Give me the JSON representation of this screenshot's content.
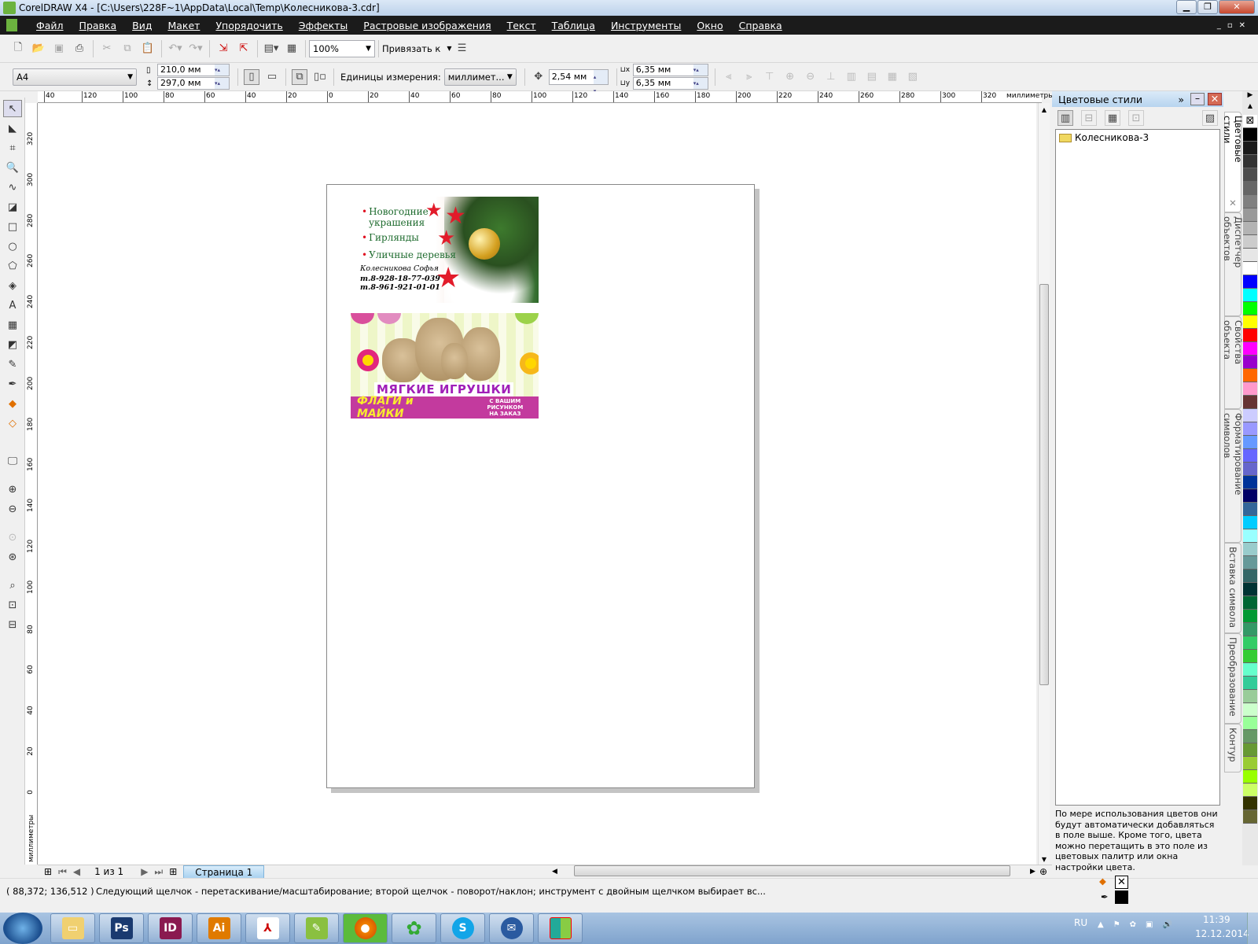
{
  "window": {
    "title": "CorelDRAW X4 - [C:\\Users\\228F~1\\AppData\\Local\\Temp\\Колесникова-3.cdr]"
  },
  "menu": [
    "Файл",
    "Правка",
    "Вид",
    "Макет",
    "Упорядочить",
    "Эффекты",
    "Растровые изображения",
    "Текст",
    "Таблица",
    "Инструменты",
    "Окно",
    "Справка"
  ],
  "toolbar": {
    "zoom": "100%",
    "snap": "Привязать к"
  },
  "propbar": {
    "paper": "A4",
    "width": "210,0 мм",
    "height": "297,0 мм",
    "units_label": "Единицы измерения:",
    "units": "миллимет...",
    "nudge": "2,54 мм",
    "dup_x": "6,35 мм",
    "dup_y": "6,35 мм"
  },
  "ruler": {
    "h_labels": [
      "40",
      "120",
      "100",
      "80",
      "60",
      "40",
      "20",
      "0",
      "20",
      "40",
      "60",
      "80",
      "100",
      "120",
      "140",
      "160",
      "180",
      "200",
      "220",
      "240",
      "260",
      "280",
      "300",
      "320"
    ],
    "units": "миллиметры",
    "v_labels": [
      "320",
      "300",
      "280",
      "260",
      "240",
      "220",
      "200",
      "180",
      "160",
      "140",
      "120",
      "100",
      "80",
      "60",
      "40",
      "20",
      "0"
    ]
  },
  "card1": {
    "items": [
      "Новогодние",
      "украшения",
      "Гирлянды",
      "Уличные деревья"
    ],
    "name": "Колесникова Софья",
    "phone1": "т.8-928-18-77-039",
    "phone2": "т.8-961-921-01-01"
  },
  "card2": {
    "title": "МЯГКИЕ ИГРУШКИ",
    "band": "ФЛАГИ и МАЙКИ",
    "sub1": "С ВАШИМ РИСУНКОМ",
    "sub2": "НА ЗАКАЗ"
  },
  "pagenav": {
    "count": "1 из 1",
    "tab": "Страница 1"
  },
  "docker": {
    "title": "Цветовые стили",
    "tree_item": "Колесникова-3",
    "hint": "По мере использования цветов они будут автоматически добавляться в поле выше. Кроме того, цвета можно перетащить в это поле из цветовых палитр или окна настройки цвета.",
    "tabs": [
      "Цветовые стили",
      "Диспетчер объектов",
      "Свойства объекта",
      "Форматирование символов",
      "Вставка символа",
      "Преобразование",
      "Контур"
    ]
  },
  "palette": [
    "#000000",
    "#1a1a1a",
    "#333333",
    "#4d4d4d",
    "#666666",
    "#808080",
    "#999999",
    "#b3b3b3",
    "#cccccc",
    "#e6e6e6",
    "#ffffff",
    "#0000ff",
    "#00ffff",
    "#00ff00",
    "#ffff00",
    "#ff0000",
    "#ff00ff",
    "#9900cc",
    "#ff6600",
    "#ff99cc",
    "#663333",
    "#ccccff",
    "#9999ff",
    "#6699ff",
    "#6666ff",
    "#6666cc",
    "#003399",
    "#000066",
    "#336699",
    "#00ccff",
    "#99ffff",
    "#99cccc",
    "#669999",
    "#336666",
    "#003333",
    "#006633",
    "#009933",
    "#339966",
    "#33cc66",
    "#33cc33",
    "#66ffcc",
    "#33cc99",
    "#99cc99",
    "#ccffcc",
    "#99ff99",
    "#669966",
    "#669933",
    "#99cc33",
    "#99ff00",
    "#ccff66",
    "#333300",
    "#666633"
  ],
  "status": {
    "coords": "( 88,372; 136,512 )",
    "message": "Следующий щелчок - перетаскивание/масштабирование; второй щелчок - поворот/наклон; инструмент с двойным щелчком выбирает вс..."
  },
  "taskbar": {
    "apps": [
      "Ps",
      "ID",
      "Ai"
    ],
    "lang": "RU",
    "time": "11:39",
    "date": "12.12.2014"
  }
}
